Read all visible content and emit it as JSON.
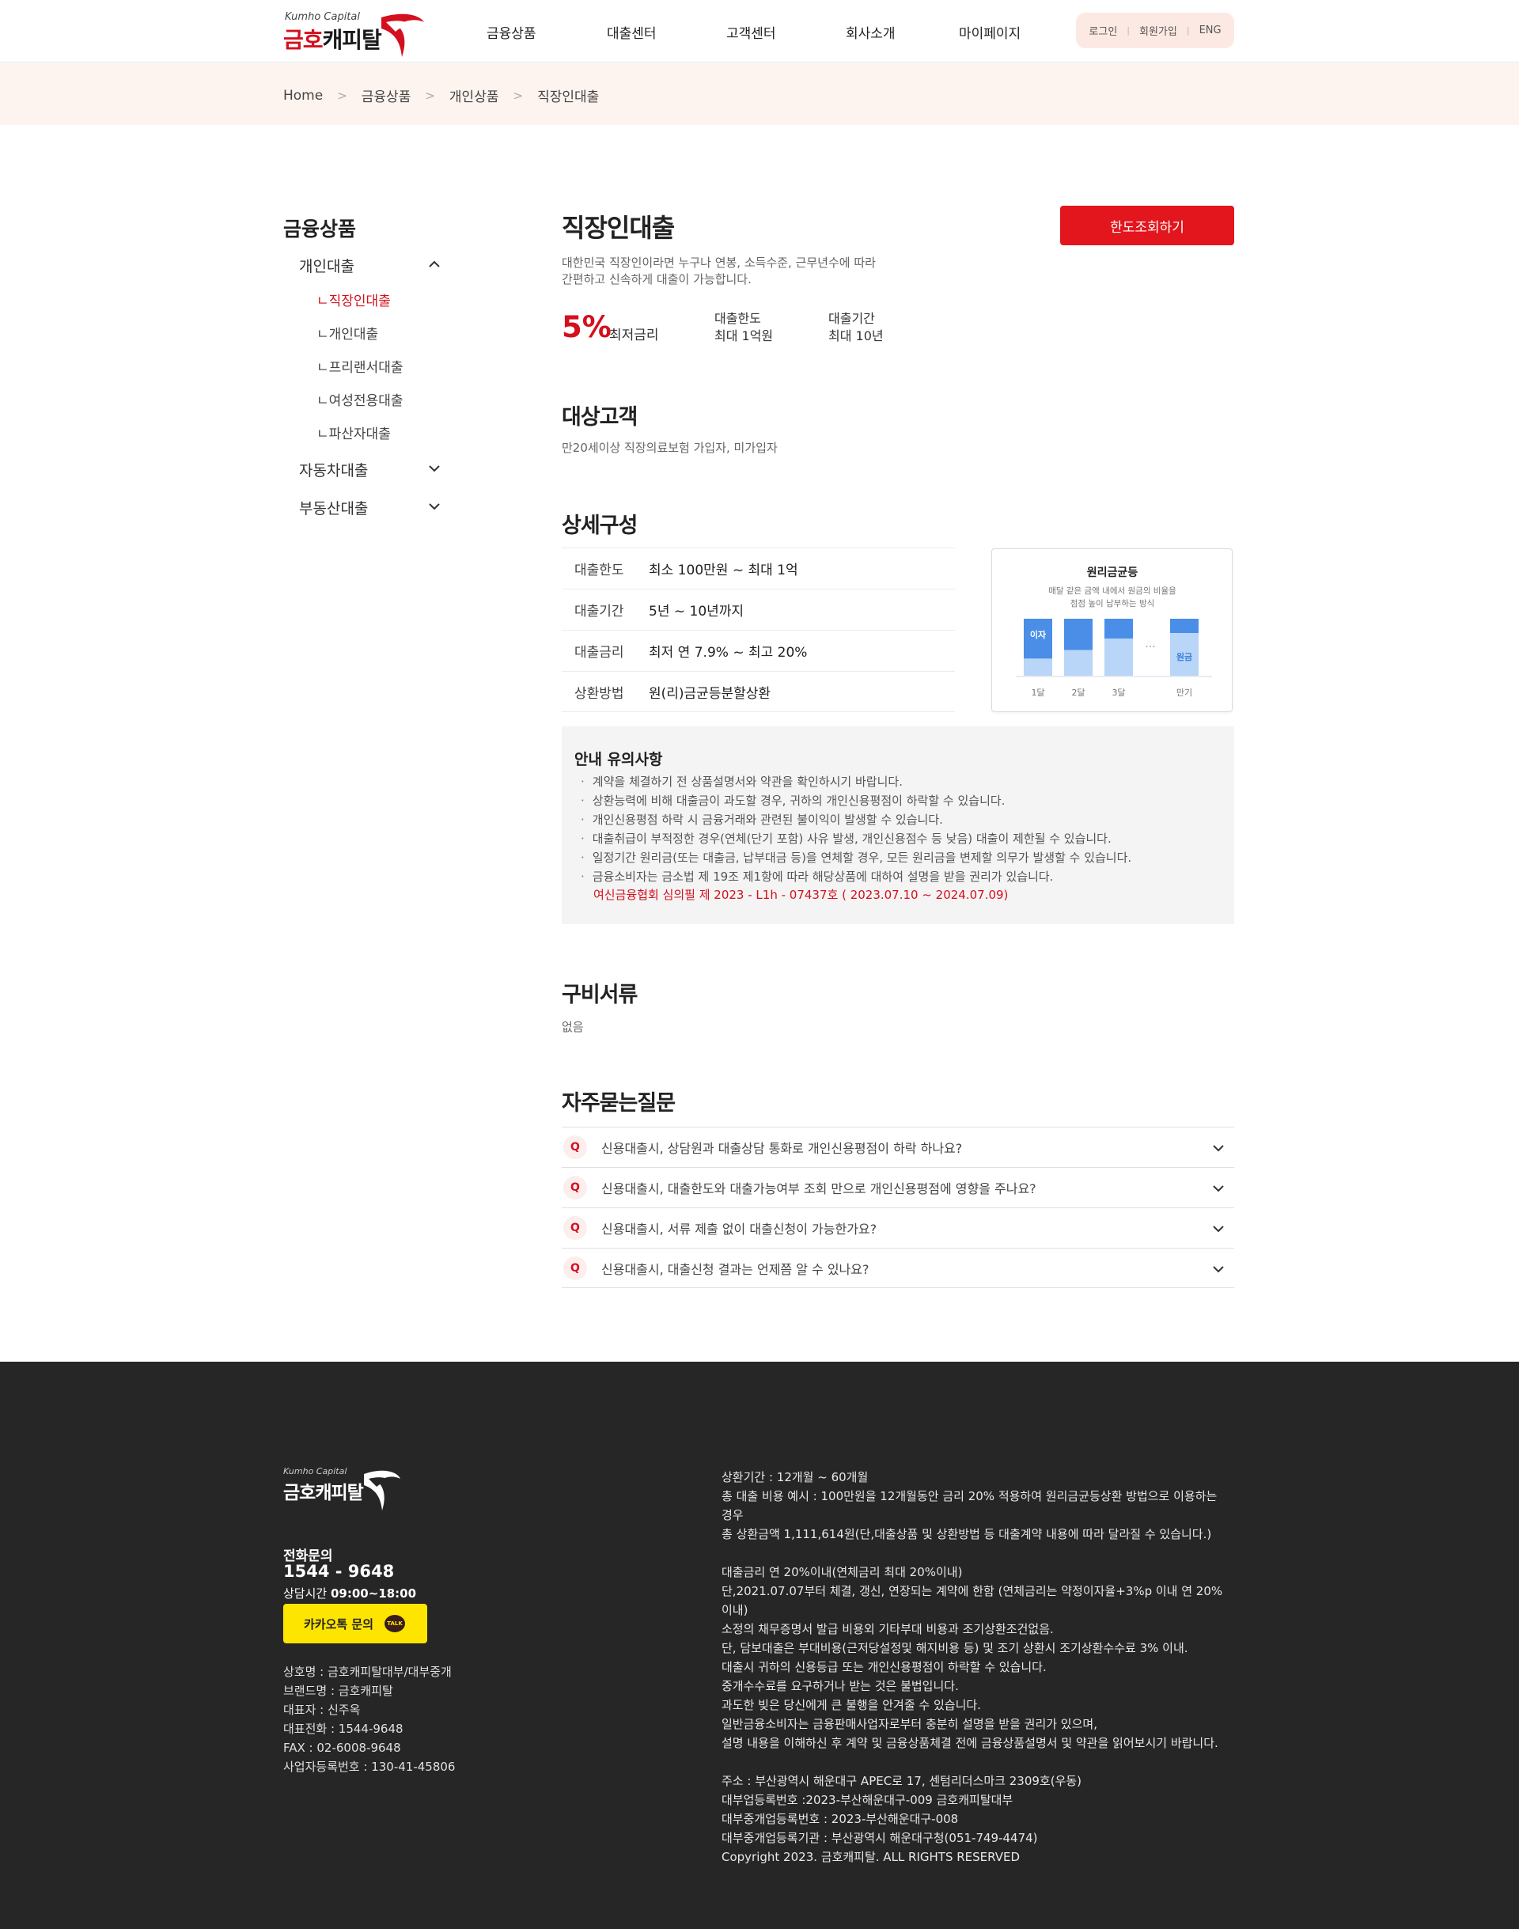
{
  "header": {
    "logo_en": "Kumho Capital",
    "logo_ko_red": "금호",
    "logo_ko_black": "캐피탈",
    "nav": [
      "금융상품",
      "대출센터",
      "고객센터",
      "회사소개",
      "마이페이지"
    ],
    "util": {
      "login": "로그인",
      "join": "회원가입",
      "lang": "ENG"
    }
  },
  "breadcrumb": [
    "Home",
    "금융상품",
    "개인상품",
    "직장인대출"
  ],
  "sidebar": {
    "title": "금융상품",
    "groups": [
      {
        "label": "개인대출",
        "expanded": true,
        "items": [
          "ㄴ직장인대출",
          "ㄴ개인대출",
          "ㄴ프리랜서대출",
          "ㄴ여성전용대출",
          "ㄴ파산자대출"
        ]
      },
      {
        "label": "자동차대출",
        "expanded": false
      },
      {
        "label": "부동산대출",
        "expanded": false
      }
    ]
  },
  "product": {
    "title": "직장인대출",
    "desc_line1": "대한민국 직장인이라면 누구나 연봉, 소득수준, 근무년수에 따라",
    "desc_line2": "간편하고 신속하게 대출이 가능합니다.",
    "cta": "한도조회하기",
    "rate_value": "5%",
    "rate_label": "최저금리",
    "limit_label": "대출한도",
    "limit_value": "최대 1억원",
    "period_label": "대출기간",
    "period_value": "최대 10년"
  },
  "target": {
    "heading": "대상고객",
    "text": "만20세이상 직장의료보험 가입자, 미가입자"
  },
  "detail": {
    "heading": "상세구성",
    "rows": [
      {
        "k": "대출한도",
        "v": "최소 100만원 ~ 최대 1억"
      },
      {
        "k": "대출기간",
        "v": "5년 ~ 10년까지"
      },
      {
        "k": "대출금리",
        "v": "최저 연 7.9% ~ 최고 20%"
      },
      {
        "k": "상환방법",
        "v": "원(리)금균등분할상환"
      }
    ],
    "graph": {
      "title": "원리금균등",
      "sub1": "매달 같은 금액 내에서 원금의 비율을",
      "sub2": "점점 높이 납부하는 방식",
      "interest_label": "이자",
      "principal_label": "원금",
      "dots": "···",
      "x_labels": [
        "1달",
        "2달",
        "3달",
        "만기"
      ],
      "principal_share": [
        0.3,
        0.45,
        0.65,
        0.75
      ],
      "colors": {
        "interest": "#4a8ee8",
        "principal": "#b9d5f7"
      }
    }
  },
  "notice": {
    "title": "안내 유의사항",
    "items": [
      "계약을 체결하기 전 상품설명서와 약관을 확인하시기 바랍니다.",
      "상환능력에 비해 대출금이 과도할 경우, 귀하의 개인신용평점이 하락할 수 있습니다.",
      "개인신용평점 하락 시 금융거래와 관련된 불이익이 발생할 수 있습니다.",
      "대출취급이 부적정한 경우(연체(단기 포함) 사유 발생, 개인신용점수 등 낮음) 대출이 제한될 수 있습니다.",
      "일정기간 원리금(또는 대출금, 납부대금 등)을 연체할 경우, 모든 원리금을 변제할 의무가 발생할 수 있습니다.",
      "금융소비자는 금소법 제 19조 제1항에 따라 해당상품에 대하여 설명을 받을 권리가 있습니다."
    ],
    "review": "여신금융협회 심의필 제 2023 - L1h - 07437호 ( 2023.07.10 ~ 2024.07.09)"
  },
  "documents": {
    "heading": "구비서류",
    "text": "없음"
  },
  "faq": {
    "heading": "자주묻는질문",
    "q_badge": "Q",
    "items": [
      "신용대출시, 상담원과 대출상담 통화로 개인신용평점이 하락 하나요?",
      "신용대출시, 대출한도와 대출가능여부 조회 만으로 개인신용평점에 영향을 주나요?",
      "신용대출시, 서류 제출 없이 대출신청이 가능한가요?",
      "신용대출시, 대출신청 결과는 언제쯤 알 수 있나요?"
    ]
  },
  "footer": {
    "logo_en": "Kumho Capital",
    "logo_ko": "금호캐피탈",
    "tel_label": "전화문의",
    "tel": "1544 - 9648",
    "hours_label": "상담시간",
    "hours": "09:00~18:00",
    "kakao": "카카오톡 문의",
    "talk_badge": "TALK",
    "info": [
      "상호명 : 금호캐피탈대부/대부중개",
      "브랜드명 : 금호캐피탈",
      "대표자 : 신주옥",
      "대표전화 : 1544-9648",
      "FAX : 02-6008-9648",
      "사업자등록번호 : 130-41-45806"
    ],
    "right_block1": [
      "상환기간 : 12개월 ~ 60개월",
      "총 대출 비용 예시 : 100만원을 12개월동안 금리 20% 적용하여 원리금균등상환 방법으로 이용하는 경우",
      "총 상환금액 1,111,614원(단,대출상품 및 상환방법 등 대출계약 내용에 따라 달라질 수 있습니다.)"
    ],
    "right_block2": [
      "대출금리 연 20%이내(연체금리 최대 20%이내)",
      "단,2021.07.07부터 체결, 갱신, 연장되는 계약에 한함 (연체금리는 약정이자율+3%p 이내 연 20%이내)",
      "소정의 채무증명서 발급 비용외 기타부대 비용과 조기상환조건없음.",
      "단, 담보대출은 부대비용(근저당설정및 해지비용 등) 및 조기 상환시 조기상환수수료 3% 이내.",
      "대출시 귀하의 신용등급 또는 개인신용평점이 하락할 수 있습니다.",
      "중개수수료를 요구하거나 받는 것은 불법입니다.",
      "과도한 빚은 당신에게 큰 불행을 안겨줄 수 있습니다.",
      "일반금융소비자는 금융판매사업자로부터 충분히 설명을 받을 권리가 있으며,",
      "설명 내용을 이해하신 후 계약 및 금융상품체결 전에 금융상품설명서 및 약관을 읽어보시기 바랍니다."
    ],
    "right_block3": [
      "주소 : 부산광역시 해운대구 APEC로 17, 센텀리더스마크 2309호(우동)",
      "대부업등록번호 :2023-부산해운대구-009 금호캐피탈대부",
      "대부중개업등록번호 : 2023-부산해운대구-008",
      "대부중개업등록기관 : 부산광역시 해운대구청(051-749-4474)",
      "Copyright 2023. 금호캐피탈. ALL RIGHTS RESERVED"
    ]
  }
}
